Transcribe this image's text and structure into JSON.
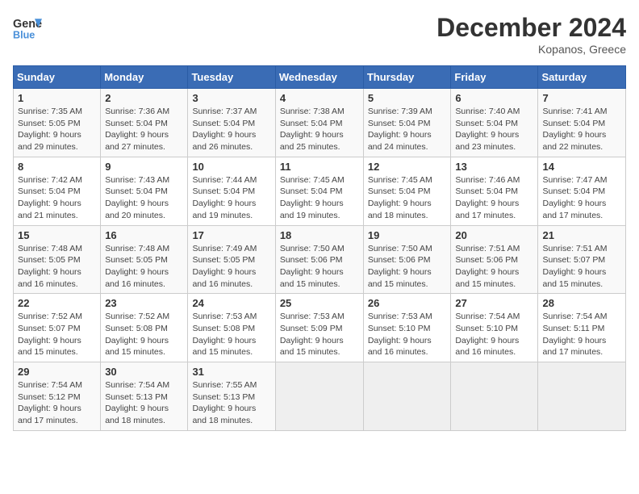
{
  "header": {
    "logo_line1": "General",
    "logo_line2": "Blue",
    "month_title": "December 2024",
    "location": "Kopanos, Greece"
  },
  "weekdays": [
    "Sunday",
    "Monday",
    "Tuesday",
    "Wednesday",
    "Thursday",
    "Friday",
    "Saturday"
  ],
  "weeks": [
    [
      {
        "day": "1",
        "sunrise": "Sunrise: 7:35 AM",
        "sunset": "Sunset: 5:05 PM",
        "daylight": "Daylight: 9 hours and 29 minutes."
      },
      {
        "day": "2",
        "sunrise": "Sunrise: 7:36 AM",
        "sunset": "Sunset: 5:04 PM",
        "daylight": "Daylight: 9 hours and 27 minutes."
      },
      {
        "day": "3",
        "sunrise": "Sunrise: 7:37 AM",
        "sunset": "Sunset: 5:04 PM",
        "daylight": "Daylight: 9 hours and 26 minutes."
      },
      {
        "day": "4",
        "sunrise": "Sunrise: 7:38 AM",
        "sunset": "Sunset: 5:04 PM",
        "daylight": "Daylight: 9 hours and 25 minutes."
      },
      {
        "day": "5",
        "sunrise": "Sunrise: 7:39 AM",
        "sunset": "Sunset: 5:04 PM",
        "daylight": "Daylight: 9 hours and 24 minutes."
      },
      {
        "day": "6",
        "sunrise": "Sunrise: 7:40 AM",
        "sunset": "Sunset: 5:04 PM",
        "daylight": "Daylight: 9 hours and 23 minutes."
      },
      {
        "day": "7",
        "sunrise": "Sunrise: 7:41 AM",
        "sunset": "Sunset: 5:04 PM",
        "daylight": "Daylight: 9 hours and 22 minutes."
      }
    ],
    [
      {
        "day": "8",
        "sunrise": "Sunrise: 7:42 AM",
        "sunset": "Sunset: 5:04 PM",
        "daylight": "Daylight: 9 hours and 21 minutes."
      },
      {
        "day": "9",
        "sunrise": "Sunrise: 7:43 AM",
        "sunset": "Sunset: 5:04 PM",
        "daylight": "Daylight: 9 hours and 20 minutes."
      },
      {
        "day": "10",
        "sunrise": "Sunrise: 7:44 AM",
        "sunset": "Sunset: 5:04 PM",
        "daylight": "Daylight: 9 hours and 19 minutes."
      },
      {
        "day": "11",
        "sunrise": "Sunrise: 7:45 AM",
        "sunset": "Sunset: 5:04 PM",
        "daylight": "Daylight: 9 hours and 19 minutes."
      },
      {
        "day": "12",
        "sunrise": "Sunrise: 7:45 AM",
        "sunset": "Sunset: 5:04 PM",
        "daylight": "Daylight: 9 hours and 18 minutes."
      },
      {
        "day": "13",
        "sunrise": "Sunrise: 7:46 AM",
        "sunset": "Sunset: 5:04 PM",
        "daylight": "Daylight: 9 hours and 17 minutes."
      },
      {
        "day": "14",
        "sunrise": "Sunrise: 7:47 AM",
        "sunset": "Sunset: 5:04 PM",
        "daylight": "Daylight: 9 hours and 17 minutes."
      }
    ],
    [
      {
        "day": "15",
        "sunrise": "Sunrise: 7:48 AM",
        "sunset": "Sunset: 5:05 PM",
        "daylight": "Daylight: 9 hours and 16 minutes."
      },
      {
        "day": "16",
        "sunrise": "Sunrise: 7:48 AM",
        "sunset": "Sunset: 5:05 PM",
        "daylight": "Daylight: 9 hours and 16 minutes."
      },
      {
        "day": "17",
        "sunrise": "Sunrise: 7:49 AM",
        "sunset": "Sunset: 5:05 PM",
        "daylight": "Daylight: 9 hours and 16 minutes."
      },
      {
        "day": "18",
        "sunrise": "Sunrise: 7:50 AM",
        "sunset": "Sunset: 5:06 PM",
        "daylight": "Daylight: 9 hours and 15 minutes."
      },
      {
        "day": "19",
        "sunrise": "Sunrise: 7:50 AM",
        "sunset": "Sunset: 5:06 PM",
        "daylight": "Daylight: 9 hours and 15 minutes."
      },
      {
        "day": "20",
        "sunrise": "Sunrise: 7:51 AM",
        "sunset": "Sunset: 5:06 PM",
        "daylight": "Daylight: 9 hours and 15 minutes."
      },
      {
        "day": "21",
        "sunrise": "Sunrise: 7:51 AM",
        "sunset": "Sunset: 5:07 PM",
        "daylight": "Daylight: 9 hours and 15 minutes."
      }
    ],
    [
      {
        "day": "22",
        "sunrise": "Sunrise: 7:52 AM",
        "sunset": "Sunset: 5:07 PM",
        "daylight": "Daylight: 9 hours and 15 minutes."
      },
      {
        "day": "23",
        "sunrise": "Sunrise: 7:52 AM",
        "sunset": "Sunset: 5:08 PM",
        "daylight": "Daylight: 9 hours and 15 minutes."
      },
      {
        "day": "24",
        "sunrise": "Sunrise: 7:53 AM",
        "sunset": "Sunset: 5:08 PM",
        "daylight": "Daylight: 9 hours and 15 minutes."
      },
      {
        "day": "25",
        "sunrise": "Sunrise: 7:53 AM",
        "sunset": "Sunset: 5:09 PM",
        "daylight": "Daylight: 9 hours and 15 minutes."
      },
      {
        "day": "26",
        "sunrise": "Sunrise: 7:53 AM",
        "sunset": "Sunset: 5:10 PM",
        "daylight": "Daylight: 9 hours and 16 minutes."
      },
      {
        "day": "27",
        "sunrise": "Sunrise: 7:54 AM",
        "sunset": "Sunset: 5:10 PM",
        "daylight": "Daylight: 9 hours and 16 minutes."
      },
      {
        "day": "28",
        "sunrise": "Sunrise: 7:54 AM",
        "sunset": "Sunset: 5:11 PM",
        "daylight": "Daylight: 9 hours and 17 minutes."
      }
    ],
    [
      {
        "day": "29",
        "sunrise": "Sunrise: 7:54 AM",
        "sunset": "Sunset: 5:12 PM",
        "daylight": "Daylight: 9 hours and 17 minutes."
      },
      {
        "day": "30",
        "sunrise": "Sunrise: 7:54 AM",
        "sunset": "Sunset: 5:13 PM",
        "daylight": "Daylight: 9 hours and 18 minutes."
      },
      {
        "day": "31",
        "sunrise": "Sunrise: 7:55 AM",
        "sunset": "Sunset: 5:13 PM",
        "daylight": "Daylight: 9 hours and 18 minutes."
      },
      null,
      null,
      null,
      null
    ]
  ]
}
